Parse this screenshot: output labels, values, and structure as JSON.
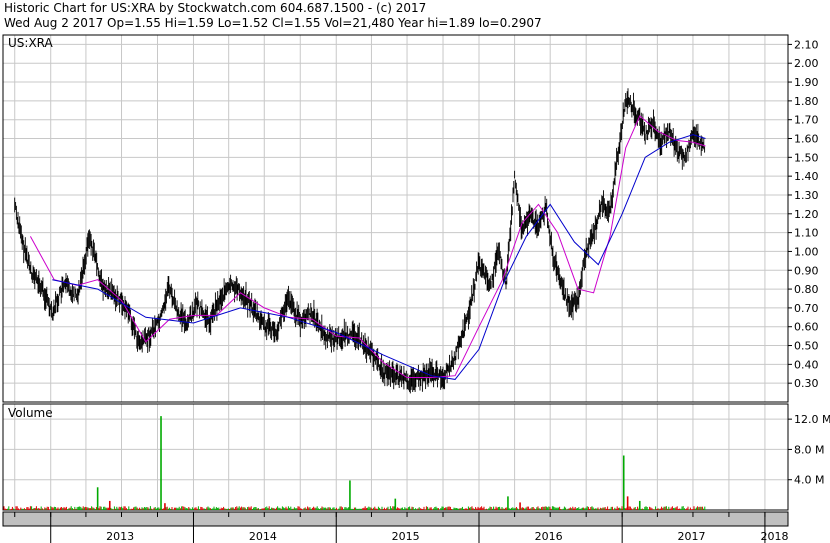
{
  "header": {
    "line1": "Historic Chart for US:XRA by Stockwatch.com 604.687.1500 - (c) 2017",
    "line2": "Wed Aug  2 2017   Op=1.55  Hi=1.59  Lo=1.52  Cl=1.55  Vol=21,480   Year hi=1.89  lo=0.2907"
  },
  "colors": {
    "price": "#000000",
    "ma_short": "#cc00cc",
    "ma_long": "#0000cc",
    "vol_up": "#00aa00",
    "vol_down": "#dd0000",
    "grid": "#c8c8c8",
    "xaxis_band": "#c0c0c0"
  },
  "chart_data": [
    {
      "type": "line",
      "title": "US:XRA",
      "ylim": [
        0.2,
        2.15
      ],
      "yticks": [
        "2.10",
        "2.00",
        "1.90",
        "1.80",
        "1.70",
        "1.60",
        "1.50",
        "1.40",
        "1.30",
        "1.20",
        "1.10",
        "1.00",
        "0.90",
        "0.80",
        "0.70",
        "0.60",
        "0.50",
        "0.40",
        "0.30"
      ],
      "xlim": [
        "2012-09-01",
        "2018-03-01"
      ],
      "grid": true,
      "series": [
        {
          "key": "price",
          "x": [
            "2012-10-01",
            "2012-10-20",
            "2012-11-15",
            "2012-12-10",
            "2013-01-05",
            "2013-02-05",
            "2013-03-10",
            "2013-04-10",
            "2013-05-15",
            "2013-06-20",
            "2013-07-20",
            "2013-08-15",
            "2013-09-10",
            "2013-10-10",
            "2013-10-30",
            "2013-11-20",
            "2013-12-15",
            "2014-01-10",
            "2014-02-10",
            "2014-03-10",
            "2014-04-10",
            "2014-05-05",
            "2014-06-01",
            "2014-07-01",
            "2014-08-01",
            "2014-09-01",
            "2014-10-01",
            "2014-11-01",
            "2014-12-01",
            "2015-01-01",
            "2015-02-01",
            "2015-03-01",
            "2015-04-01",
            "2015-05-01",
            "2015-06-01",
            "2015-07-01",
            "2015-08-01",
            "2015-09-01",
            "2015-10-01",
            "2015-11-01",
            "2015-12-01",
            "2016-01-01",
            "2016-02-01",
            "2016-02-20",
            "2016-03-10",
            "2016-04-01",
            "2016-04-20",
            "2016-05-10",
            "2016-06-01",
            "2016-06-20",
            "2016-07-10",
            "2016-08-01",
            "2016-08-20",
            "2016-09-10",
            "2016-10-01",
            "2016-10-20",
            "2016-11-10",
            "2016-12-01",
            "2016-12-20",
            "2017-01-10",
            "2017-02-01",
            "2017-02-15",
            "2017-03-01",
            "2017-03-20",
            "2017-04-10",
            "2017-05-01",
            "2017-05-20",
            "2017-06-10",
            "2017-07-01",
            "2017-07-20",
            "2017-08-02"
          ],
          "y": [
            1.25,
            1.05,
            0.88,
            0.8,
            0.68,
            0.82,
            0.76,
            1.08,
            0.8,
            0.76,
            0.68,
            0.5,
            0.55,
            0.65,
            0.82,
            0.68,
            0.62,
            0.72,
            0.62,
            0.75,
            0.82,
            0.78,
            0.7,
            0.6,
            0.58,
            0.75,
            0.62,
            0.68,
            0.55,
            0.54,
            0.56,
            0.54,
            0.46,
            0.36,
            0.34,
            0.31,
            0.32,
            0.36,
            0.33,
            0.44,
            0.63,
            0.93,
            0.82,
            1.0,
            0.82,
            1.4,
            1.1,
            1.2,
            1.12,
            1.24,
            0.95,
            0.8,
            0.7,
            0.75,
            1.0,
            1.1,
            1.25,
            1.2,
            1.5,
            1.82,
            1.75,
            1.7,
            1.62,
            1.68,
            1.58,
            1.63,
            1.55,
            1.48,
            1.64,
            1.58,
            1.55
          ]
        },
        {
          "key": "ma_short",
          "x": [
            "2012-11-10",
            "2013-01-10",
            "2013-03-10",
            "2013-05-01",
            "2013-07-01",
            "2013-09-01",
            "2013-11-01",
            "2014-01-01",
            "2014-03-01",
            "2014-05-01",
            "2014-07-01",
            "2014-09-01",
            "2014-11-01",
            "2015-01-01",
            "2015-03-01",
            "2015-05-01",
            "2015-07-01",
            "2015-09-01",
            "2015-11-01",
            "2016-01-01",
            "2016-03-01",
            "2016-04-20",
            "2016-06-01",
            "2016-07-20",
            "2016-09-10",
            "2016-10-20",
            "2016-12-01",
            "2017-01-10",
            "2017-02-15",
            "2017-04-01",
            "2017-05-20",
            "2017-07-01",
            "2017-08-02"
          ],
          "y": [
            1.08,
            0.85,
            0.82,
            0.85,
            0.74,
            0.52,
            0.64,
            0.66,
            0.66,
            0.78,
            0.7,
            0.65,
            0.64,
            0.55,
            0.54,
            0.41,
            0.33,
            0.33,
            0.34,
            0.6,
            0.85,
            1.15,
            1.25,
            1.1,
            0.8,
            0.78,
            1.08,
            1.55,
            1.72,
            1.64,
            1.59,
            1.58,
            1.56
          ]
        },
        {
          "key": "ma_long",
          "x": [
            "2013-01-05",
            "2013-05-01",
            "2013-09-01",
            "2014-01-01",
            "2014-05-01",
            "2014-09-01",
            "2015-01-01",
            "2015-05-01",
            "2015-09-01",
            "2015-11-01",
            "2016-01-01",
            "2016-03-01",
            "2016-05-01",
            "2016-07-01",
            "2016-09-01",
            "2016-11-01",
            "2017-01-01",
            "2017-03-01",
            "2017-05-01",
            "2017-07-01",
            "2017-08-02"
          ],
          "y": [
            0.85,
            0.8,
            0.65,
            0.62,
            0.7,
            0.65,
            0.57,
            0.45,
            0.34,
            0.32,
            0.48,
            0.82,
            1.08,
            1.25,
            1.05,
            0.93,
            1.2,
            1.5,
            1.58,
            1.62,
            1.6
          ]
        }
      ]
    },
    {
      "type": "bar",
      "title": "Volume",
      "ylim": [
        0,
        14
      ],
      "yticks": [
        "12.0 M",
        "8.0 M",
        "4.0 M"
      ],
      "xlim": [
        "2012-09-01",
        "2018-03-01"
      ],
      "spikes": [
        {
          "x": "2013-05-01",
          "value": 3.0,
          "dir": "up"
        },
        {
          "x": "2013-06-01",
          "value": 1.2,
          "dir": "down"
        },
        {
          "x": "2013-10-10",
          "value": 12.4,
          "dir": "up"
        },
        {
          "x": "2013-10-20",
          "value": 0.9,
          "dir": "down"
        },
        {
          "x": "2015-02-05",
          "value": 3.9,
          "dir": "up"
        },
        {
          "x": "2015-06-01",
          "value": 1.5,
          "dir": "up"
        },
        {
          "x": "2016-03-15",
          "value": 1.8,
          "dir": "up"
        },
        {
          "x": "2016-04-15",
          "value": 1.0,
          "dir": "down"
        },
        {
          "x": "2017-01-05",
          "value": 7.2,
          "dir": "up"
        },
        {
          "x": "2017-01-15",
          "value": 1.8,
          "dir": "down"
        },
        {
          "x": "2017-02-15",
          "value": 1.2,
          "dir": "up"
        }
      ],
      "baseline": 0.3
    }
  ],
  "xaxis": {
    "years": [
      {
        "label": "2013",
        "date": "2013-01-01"
      },
      {
        "label": "2014",
        "date": "2014-01-01"
      },
      {
        "label": "2015",
        "date": "2015-01-01"
      },
      {
        "label": "2016",
        "date": "2016-01-01"
      },
      {
        "label": "2017",
        "date": "2017-01-01"
      },
      {
        "label": "2018",
        "date": "2018-01-01"
      }
    ],
    "month_grid": [
      "2012-10-01",
      "2013-01-01",
      "2013-04-01",
      "2013-07-01",
      "2013-10-01",
      "2014-01-01",
      "2014-04-01",
      "2014-07-01",
      "2014-10-01",
      "2015-01-01",
      "2015-04-01",
      "2015-07-01",
      "2015-10-01",
      "2016-01-01",
      "2016-04-01",
      "2016-07-01",
      "2016-10-01",
      "2017-01-01",
      "2017-04-01",
      "2017-07-01",
      "2017-10-01",
      "2018-01-01"
    ],
    "year_bounds": [
      "2013-01-01",
      "2014-01-01",
      "2015-01-01",
      "2016-01-01",
      "2017-01-01",
      "2018-01-01"
    ]
  }
}
